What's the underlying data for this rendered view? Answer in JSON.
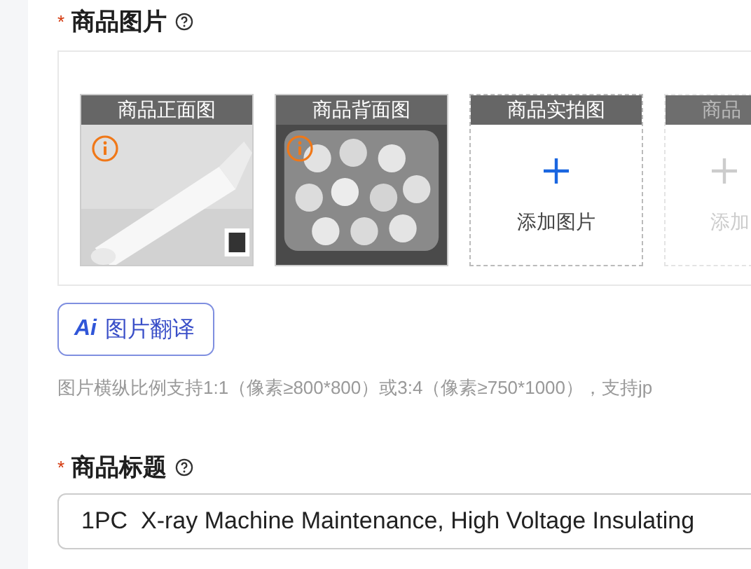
{
  "images_section": {
    "required_mark": "*",
    "label": "商品图片",
    "slots": [
      {
        "title": "商品正面图",
        "warning": true,
        "disabled": false
      },
      {
        "title": "商品背面图",
        "warning": true,
        "disabled": false
      },
      {
        "kind": "add",
        "title": "商品实拍图",
        "add_label": "添加图片",
        "disabled": false
      },
      {
        "kind": "add",
        "title": "商品",
        "add_label": "添加",
        "disabled": true
      }
    ],
    "translate_button": {
      "badge": "Ai",
      "label": "图片翻译"
    },
    "hint": "图片横纵比例支持1:1（像素≥800*800）或3:4（像素≥750*1000），支持jp"
  },
  "title_section": {
    "required_mark": "*",
    "label": "商品标题",
    "value": "1PC  X-ray Machine Maintenance, High Voltage Insulating"
  }
}
